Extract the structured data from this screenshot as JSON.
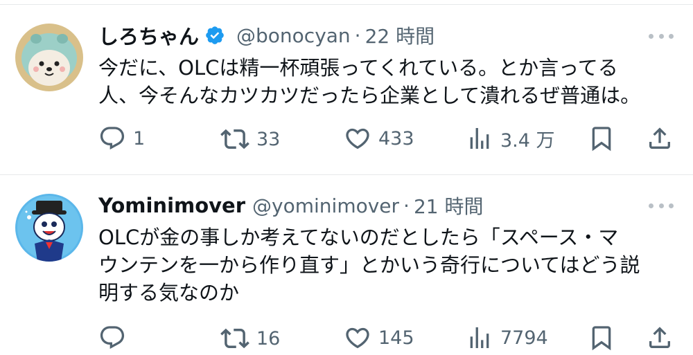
{
  "tweets": [
    {
      "name": "しろちゃん",
      "handle": "@bonocyan",
      "separator": "·",
      "time": "22 時間",
      "verified": true,
      "text_lines": [
        "今だに、OLCは精一杯頑張ってくれている。とか言ってる",
        "人、今そんなカツカツだったら企業として潰れるぜ普通は。"
      ],
      "replies": "1",
      "reposts": "33",
      "likes": "433",
      "views": "3.4 万"
    },
    {
      "name": "Yominimover",
      "handle": "@yominimover",
      "separator": "·",
      "time": "21 時間",
      "verified": false,
      "text_lines": [
        "OLCが金の事しか考えてないのだとしたら「スペース・マ",
        "ウンテンを一から作り直す」とかいう奇行についてはどう説",
        "明する気なのか"
      ],
      "replies": "",
      "reposts": "16",
      "likes": "145",
      "views": "7794"
    }
  ],
  "colors": {
    "text": "#0f1419",
    "secondary": "#536471",
    "verified": "#1d9bf0",
    "divider": "#e7e9ea"
  },
  "icons": [
    "reply-icon",
    "repost-icon",
    "like-icon",
    "views-icon",
    "bookmark-icon",
    "share-icon",
    "more-icon",
    "verified-badge-icon"
  ]
}
